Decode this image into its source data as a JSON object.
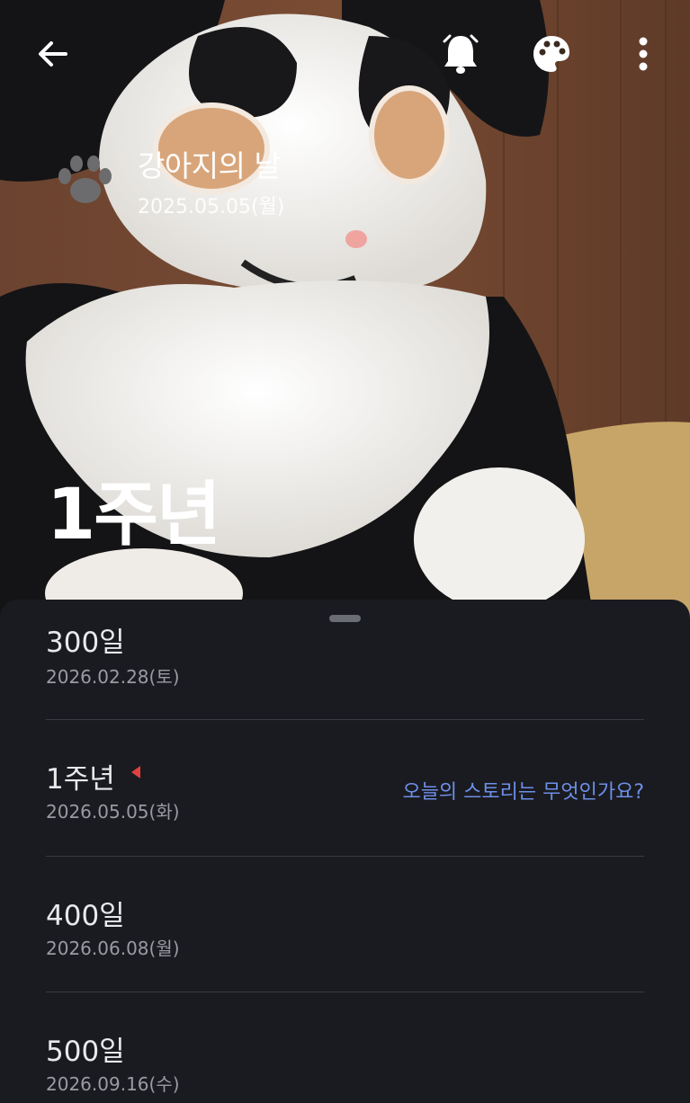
{
  "header": {
    "back_icon": "arrow-left-icon",
    "bell_icon": "bell-icon",
    "palette_icon": "palette-icon",
    "more_icon": "more-vertical-icon"
  },
  "event": {
    "icon": "paw-icon",
    "title": "강아지의 날",
    "date": "2025.05.05(월)",
    "milestone_label": "1주년"
  },
  "milestones": [
    {
      "label": "300일",
      "date": "2026.02.28(토)"
    },
    {
      "label": "1주년",
      "date": "2026.05.05(화)",
      "story_prompt": "오늘의 스토리는 무엇인가요?",
      "marker_color": "#e0413f"
    },
    {
      "label": "400일",
      "date": "2026.06.08(월)"
    },
    {
      "label": "500일",
      "date": "2026.09.16(수)"
    }
  ],
  "colors": {
    "sheet_bg": "#1a1b20",
    "accent_link": "#6d8fe8",
    "marker": "#e0413f"
  }
}
